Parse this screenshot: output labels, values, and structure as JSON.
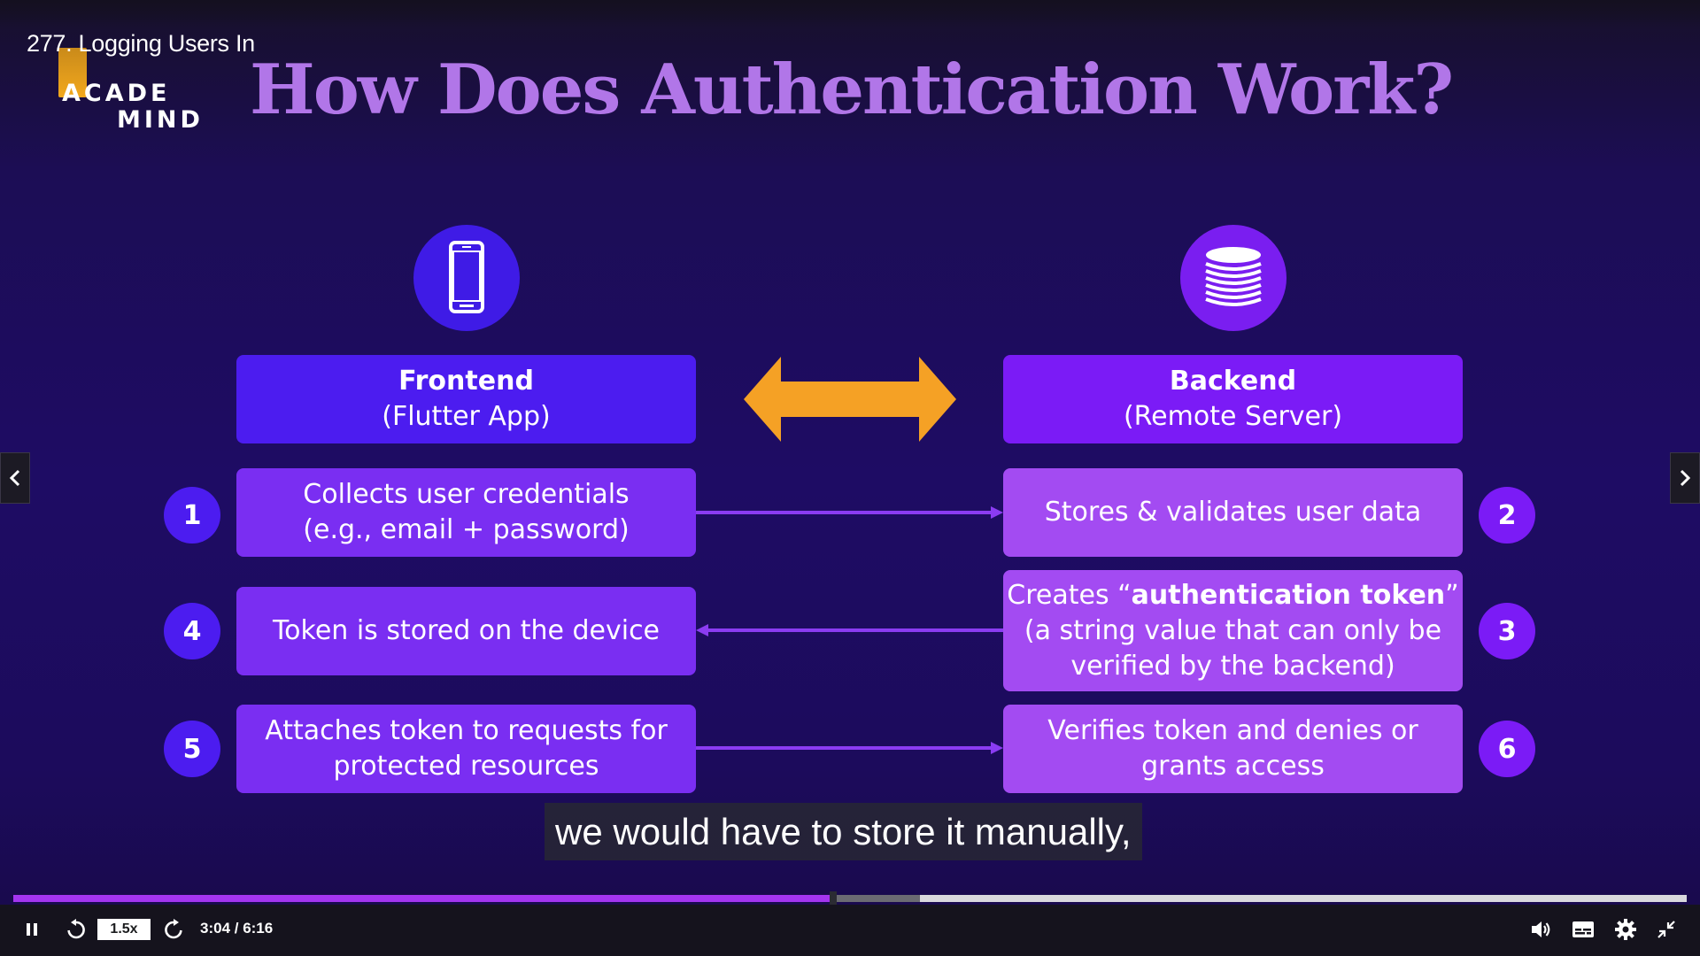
{
  "lecture": {
    "title": "277. Logging Users In"
  },
  "logo": {
    "line1": "ACADE",
    "line2": "MIND"
  },
  "slide": {
    "title": "How Does Authentication Work?",
    "frontend": {
      "title": "Frontend",
      "subtitle": "(Flutter App)"
    },
    "backend": {
      "title": "Backend",
      "subtitle": "(Remote Server)"
    },
    "steps": {
      "s1": {
        "number": "1",
        "line1": "Collects user credentials",
        "line2": "(e.g., email + password)"
      },
      "s2": {
        "number": "2",
        "line1": "Stores & validates user data"
      },
      "s3": {
        "number": "3",
        "prefix": "Creates “",
        "bold": "authentication token",
        "suffix": "”",
        "line2": "(a string value that can only be",
        "line3": "verified by the backend)"
      },
      "s4": {
        "number": "4",
        "line1": "Token is stored on the device"
      },
      "s5": {
        "number": "5",
        "line1": "Attaches token to requests for",
        "line2": "protected resources"
      },
      "s6": {
        "number": "6",
        "line1": "Verifies token and denies or",
        "line2": "grants access"
      }
    },
    "colors": {
      "title": "#b176e8",
      "frontend": "#4c1cf0",
      "backend": "#7b1bf6",
      "arrow": "#f5a125",
      "flow_line": "#8b3cf2"
    }
  },
  "caption": {
    "text": "we would have to store it manually,"
  },
  "player": {
    "speed": "1.5x",
    "time": "3:04 / 6:16",
    "progress_played_fraction": 0.49,
    "progress_buffered_fraction": 0.542,
    "icons": {
      "pause": "pause-icon",
      "rewind": "rewind-icon",
      "forward": "forward-icon",
      "volume": "volume-icon",
      "captions": "captions-icon",
      "settings": "gear-icon",
      "fullscreen": "exit-fullscreen-icon"
    }
  }
}
